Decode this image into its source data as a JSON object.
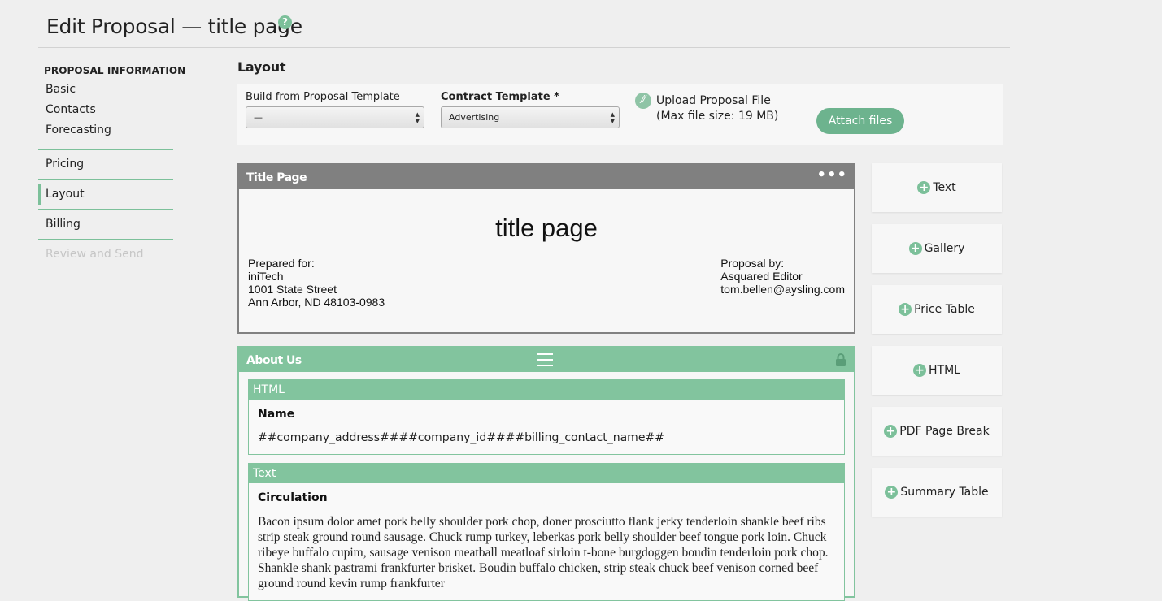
{
  "header": {
    "title": "Edit Proposal — title page",
    "help_icon": "?"
  },
  "sidebar": {
    "heading": "PROPOSAL INFORMATION",
    "items": [
      {
        "label": "Basic"
      },
      {
        "label": "Contacts"
      },
      {
        "label": "Forecasting"
      },
      {
        "label": "Pricing"
      },
      {
        "label": "Layout",
        "active": true
      },
      {
        "label": "Billing"
      },
      {
        "label": "Review and Send",
        "disabled": true
      }
    ]
  },
  "layout": {
    "title": "Layout",
    "proposal_template": {
      "label": "Build from Proposal Template",
      "value": "—"
    },
    "contract_template": {
      "label": "Contract Template *",
      "value": "Advertising"
    },
    "upload": {
      "line1": "Upload Proposal File",
      "line2": "(Max file size: 19 MB)"
    },
    "attach_button": "Attach files"
  },
  "title_page": {
    "header": "Title Page",
    "heading": "title page",
    "prepared_for": [
      "Prepared for:",
      "iniTech",
      "1001 State Street",
      "Ann Arbor, ND 48103-0983"
    ],
    "proposal_by": [
      "Proposal by:",
      "Asquared Editor",
      "tom.bellen@aysling.com"
    ]
  },
  "about_us": {
    "header": "About Us",
    "html_block": {
      "type": "HTML",
      "title": "Name",
      "body": "##company_address####company_id####billing_contact_name##"
    },
    "text_block": {
      "type": "Text",
      "title": "Circulation",
      "body": "Bacon ipsum dolor amet pork belly shoulder pork chop, doner prosciutto flank jerky tenderloin shankle beef ribs strip steak ground round sausage. Chuck rump turkey, leberkas pork belly shoulder beef tongue pork loin. Chuck ribeye buffalo cupim, sausage venison meatball meatloaf sirloin t-bone burgdoggen boudin tenderloin pork chop. Shankle shank pastrami frankfurter brisket. Boudin buffalo chicken, strip steak chuck beef venison corned beef ground round kevin rump frankfurter"
    }
  },
  "widgets": [
    "Text",
    "Gallery",
    "Price Table",
    "HTML",
    "PDF Page Break",
    "Summary Table"
  ],
  "colors": {
    "accent": "#7cc09a",
    "card_header_gray": "#808080",
    "card_header_green": "#82c49e"
  }
}
